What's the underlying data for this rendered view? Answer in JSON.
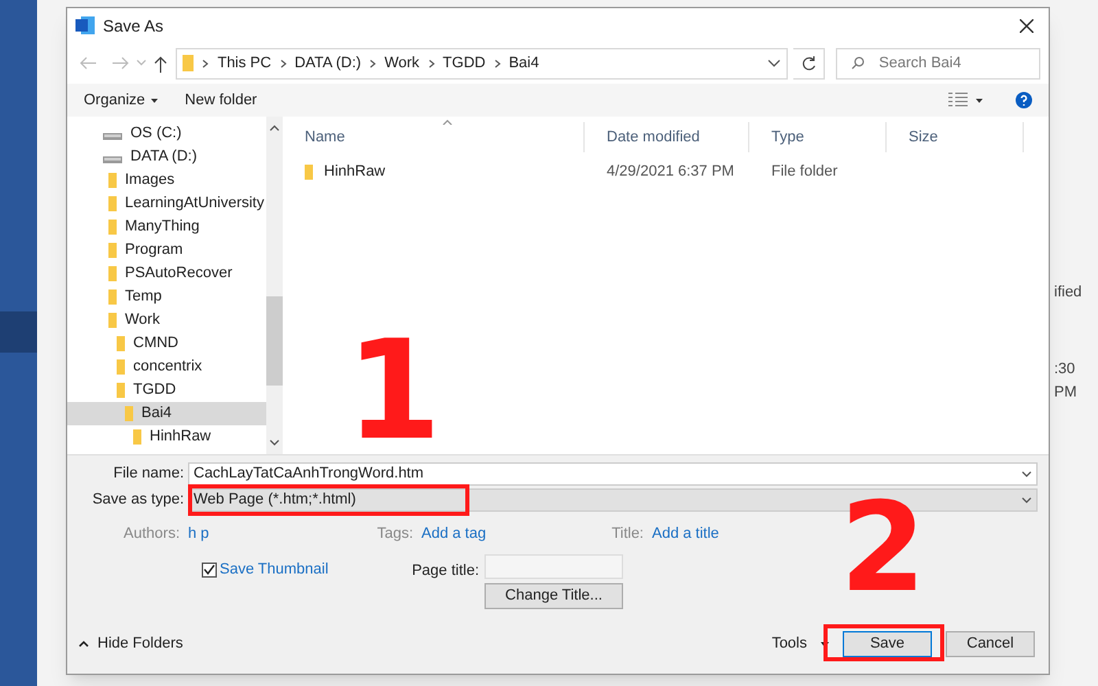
{
  "background": {
    "texts": [
      "ified",
      ":30 PM"
    ]
  },
  "window": {
    "title": "Save As"
  },
  "address_bar": {
    "path": [
      "This PC",
      "DATA (D:)",
      "Work",
      "TGDD",
      "Bai4"
    ]
  },
  "search": {
    "placeholder": "Search Bai4"
  },
  "toolbar": {
    "organize": "Organize",
    "new_folder": "New folder"
  },
  "navigation": {
    "items": [
      {
        "label": "OS (C:)",
        "kind": "drive",
        "selected": false
      },
      {
        "label": "DATA (D:)",
        "kind": "drive",
        "selected": false,
        "children": [
          {
            "label": "Images",
            "kind": "folder",
            "selected": false
          },
          {
            "label": "LearningAtUniversity",
            "kind": "folder",
            "selected": false
          },
          {
            "label": "ManyThing",
            "kind": "folder",
            "selected": false
          },
          {
            "label": "Program",
            "kind": "folder",
            "selected": false
          },
          {
            "label": "PSAutoRecover",
            "kind": "folder",
            "selected": false
          },
          {
            "label": "Temp",
            "kind": "folder",
            "selected": false
          },
          {
            "label": "Work",
            "kind": "folder",
            "selected": false,
            "children": [
              {
                "label": "CMND",
                "kind": "folder",
                "selected": false
              },
              {
                "label": "concentrix",
                "kind": "folder",
                "selected": false
              },
              {
                "label": "TGDD",
                "kind": "folder",
                "selected": false,
                "children": [
                  {
                    "label": "Bai4",
                    "kind": "folder",
                    "selected": true,
                    "children": [
                      {
                        "label": "HinhRaw",
                        "kind": "folder",
                        "selected": false
                      }
                    ]
                  }
                ]
              }
            ]
          }
        ]
      }
    ]
  },
  "file_list": {
    "columns": [
      "Name",
      "Date modified",
      "Type",
      "Size"
    ],
    "rows": [
      {
        "name": "HinhRaw",
        "date_modified": "4/29/2021 6:37 PM",
        "type": "File folder"
      }
    ]
  },
  "form": {
    "file_name_label": "File name:",
    "file_name": "CachLayTatCaAnhTrongWord.htm",
    "save_as_type_label": "Save as type:",
    "save_as_type": "Web Page (*.htm;*.html)",
    "authors_label": "Authors:",
    "authors": "h p",
    "tags_label": "Tags:",
    "tags": "Add a tag",
    "title_label": "Title:",
    "title": "Add a title",
    "save_thumbnail": {
      "label": "Save Thumbnail",
      "checked": true
    },
    "page_title_label": "Page title:",
    "change_title": "Change Title..."
  },
  "footer": {
    "hide_folders": "Hide Folders",
    "tools": "Tools",
    "save": "Save",
    "cancel": "Cancel"
  },
  "annotations": [
    {
      "text": "1"
    },
    {
      "text": "2"
    }
  ]
}
